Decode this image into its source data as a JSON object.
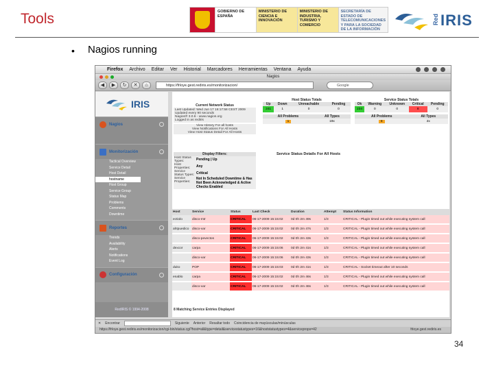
{
  "slide": {
    "title": "Tools",
    "bullet": "Nagios running",
    "page_number": "34"
  },
  "logos": {
    "gov_blocks": [
      "GOBIERNO DE ESPAÑA",
      "MINISTERIO DE CIENCIA E INNOVACIÓN",
      "MINISTERIO DE INDUSTRIA, TURISMO Y COMERCIO",
      "SECRETARÍA DE ESTADO DE TELECOMUNICACIONES Y PARA LA SOCIEDAD DE LA INFORMACIÓN"
    ],
    "rediris_red": "Red",
    "rediris_iris": "IRIS"
  },
  "browser": {
    "menu": [
      "Firefox",
      "Archivo",
      "Editar",
      "Ver",
      "Historial",
      "Marcadores",
      "Herramientas",
      "Ventana",
      "Ayuda"
    ],
    "window_title": "Nagios",
    "url": "https://frloye.gest.rediris.es/monitorizacion/",
    "search_placeholder": "Google",
    "find_label": "Encontrar",
    "find_next": "Siguiente",
    "find_prev": "Anterior",
    "find_highlight": "Resaltar todo",
    "find_match_case": "Coincidencia de mayúsculas/minúsculas",
    "status_url": "https://frloye.gest.rediris.es/monitorizacion/cgi-bin/status.cgi?host=all&type=detail&servicestatustypes=16&hoststatustypes=4&serviceprops=42",
    "status_host": "frloye.gest.rediris.es"
  },
  "sidebar": {
    "sections": [
      {
        "label": "Nagios",
        "color": "#d9531e"
      },
      {
        "label": "Monitorización",
        "color": "#3a6fc4"
      },
      {
        "label": "Reportes",
        "color": "#d9531e"
      },
      {
        "label": "Configuración",
        "color": "#c33"
      }
    ],
    "monitor_items": [
      "Tactical Overview",
      "Service Detail",
      "Host Detail",
      "hostname",
      "Host Group",
      "Service Group",
      "Status Map",
      "Problems",
      "Comments",
      "Downtime"
    ],
    "report_items": [
      "Trends",
      "Availability",
      "Alerts",
      "Notifications",
      "Event Log"
    ],
    "footer": "RedIRIS © 1994-2008"
  },
  "network_status": {
    "title": "Current Network Status",
    "lines": [
      "Last Updated: Wed Jun 17 16:17:58 CEST 2009",
      "Updated every 90 seconds",
      "Nagios® 3.0.6 - www.nagios.org",
      "Logged in as rediris"
    ],
    "links": [
      "View History For all hosts",
      "View Notifications For All Hosts",
      "View Host Status Detail For All Hosts"
    ]
  },
  "host_totals": {
    "title": "Host Status Totals",
    "headers": [
      "Up",
      "Down",
      "Unreachable",
      "Pending"
    ],
    "values": [
      "241",
      "1",
      "0",
      "0"
    ],
    "sub_headers": [
      "All Problems",
      "All Types"
    ],
    "sub_values": [
      "1",
      "19x"
    ]
  },
  "service_totals": {
    "title": "Service Status Totals",
    "headers": [
      "Ok",
      "Warning",
      "Unknown",
      "Critical",
      "Pending"
    ],
    "values": [
      "234",
      "0",
      "0",
      "8",
      "0"
    ],
    "sub_headers": [
      "All Problems",
      "All Types"
    ],
    "sub_values": [
      "8",
      "2x"
    ]
  },
  "filters": {
    "title": "Display Filters:",
    "rows": [
      [
        "Host Status Types:",
        "Pending | Up"
      ],
      [
        "Host Properties:",
        "Any"
      ],
      [
        "Service Status Types:",
        "Critical"
      ],
      [
        "Service Properties:",
        "Not In Scheduled Downtime & Has Not Been Acknowledged & Active Checks Enabled"
      ]
    ]
  },
  "service_detail_title": "Service Status Details For All Hosts",
  "service_table": {
    "headers": [
      "Host",
      "Service",
      "Status",
      "Last Check",
      "Duration",
      "Attempt",
      "Status Information"
    ],
    "rows": [
      [
        "ectiolo",
        "disco-mtr",
        "CRITICAL",
        "06-17-2009 15:15:02",
        "0d 0h 2m 49s",
        "1/3",
        "CRITICAL - Plugin timed out while executing system call"
      ],
      [
        "ahtpuedico",
        "disco-var",
        "CRITICAL",
        "06-17-2009 15:15:02",
        "0d 0h 2m 47s",
        "1/3",
        "CRITICAL - Plugin timed out while executing system call"
      ],
      [
        "",
        "disco-pevectos",
        "CRITICAL",
        "06-17-2009 15:15:02",
        "0d 0h 2m 43s",
        "1/3",
        "CRITICAL - Plugin timed out while executing system call"
      ],
      [
        "dexcor",
        "carpa",
        "CRITICAL",
        "06-17-2009 15:15:06",
        "0d 0h 2m 41s",
        "1/3",
        "CRITICAL - Plugin timed out while executing system call"
      ],
      [
        "",
        "disco-var",
        "CRITICAL",
        "06-17-2009 15:15:06",
        "0d 0h 2m 43s",
        "1/3",
        "CRITICAL - Plugin timed out while executing system call"
      ],
      [
        "duko",
        "POP",
        "CRITICAL",
        "06-17-2009 15:15:03",
        "0d 0h 2m 41s",
        "1/3",
        "CRITICAL - Socket timeout after 10 seconds"
      ],
      [
        "enablo",
        "carpa",
        "CRITICAL",
        "06-17-2009 15:15:02",
        "0d 0h 2m 46s",
        "1/3",
        "CRITICAL - Plugin timed out while executing system call"
      ],
      [
        "",
        "disco-var",
        "CRITICAL",
        "06-17-2009 15:15:02",
        "0d 0h 2m 46s",
        "1/3",
        "CRITICAL - Plugin timed out while executing system call"
      ]
    ],
    "footer": "8 Matching Service Entries Displayed"
  }
}
